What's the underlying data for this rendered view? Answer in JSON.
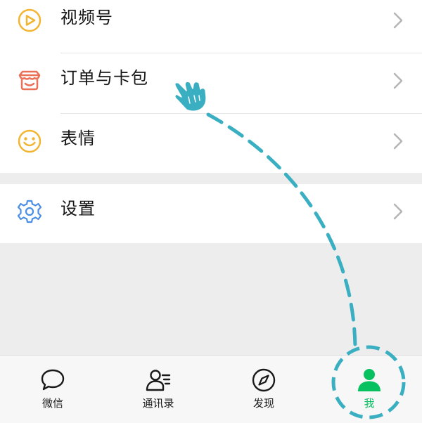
{
  "colors": {
    "accent_green": "#07c160",
    "guide_teal": "#3aafc2",
    "icon_yellow": "#f2b531",
    "icon_orange": "#ea7057",
    "icon_blue": "#4a8ee4"
  },
  "menu": {
    "group1": [
      {
        "label": "视频号",
        "icon": "play-circle-icon"
      },
      {
        "label": "订单与卡包",
        "icon": "shop-awning-icon"
      },
      {
        "label": "表情",
        "icon": "smiley-face-icon"
      }
    ],
    "group2": [
      {
        "label": "设置",
        "icon": "gear-icon"
      }
    ]
  },
  "tabbar": {
    "tabs": [
      {
        "label": "微信",
        "icon": "chat-bubble-icon",
        "active": false
      },
      {
        "label": "通讯录",
        "icon": "contacts-icon",
        "active": false
      },
      {
        "label": "发现",
        "icon": "compass-icon",
        "active": false
      },
      {
        "label": "我",
        "icon": "person-icon",
        "active": true
      }
    ]
  },
  "guide": {
    "pointer_icon": "pointing-hand-icon",
    "highlight_target": "我"
  }
}
